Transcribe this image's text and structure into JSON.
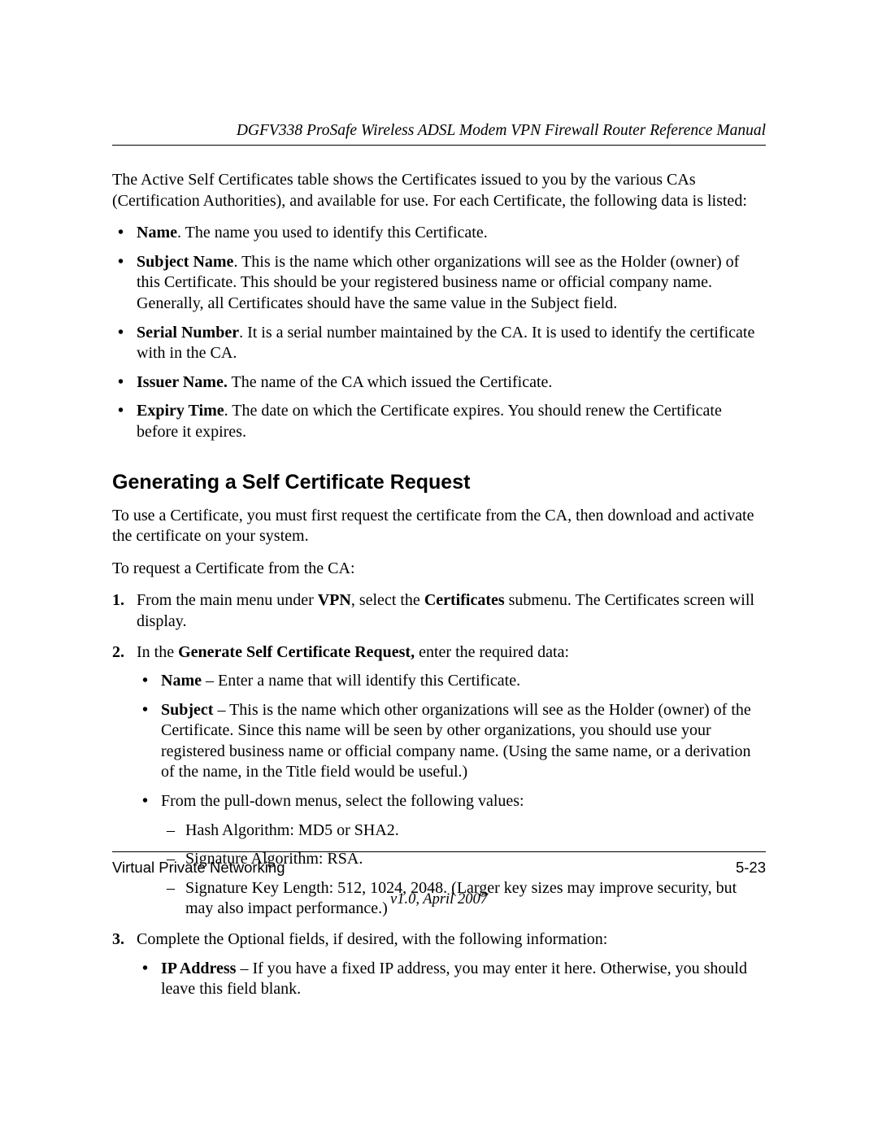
{
  "header": {
    "doc_title": "DGFV338 ProSafe Wireless ADSL Modem VPN Firewall Router Reference Manual"
  },
  "intro": "The Active Self Certificates table shows the Certificates issued to you by the various CAs (Certification Authorities), and available for use. For each Certificate, the following data is listed:",
  "top_list": [
    {
      "term": "Name",
      "desc": ". The name you used to identify this Certificate."
    },
    {
      "term": "Subject Name",
      "desc": ". This is the name which other organizations will see as the Holder (owner) of this Certificate. This should be your registered business name or official company name. Generally, all Certificates should have the same value in the Subject field."
    },
    {
      "term": "Serial Number",
      "desc": ". It is a serial number maintained by the CA. It is used to identify the certificate with in the CA."
    },
    {
      "term": "Issuer Name.",
      "desc": " The name of the CA which issued the Certificate."
    },
    {
      "term": "Expiry Time",
      "desc": ". The date on which the Certificate expires. You should renew the Certificate before it expires."
    }
  ],
  "section_heading": "Generating a Self Certificate Request",
  "para1": "To use a Certificate, you must first request the certificate from the CA, then download and activate the certificate on your system.",
  "para2": "To request a Certificate from the CA:",
  "step1": {
    "marker": "1.",
    "pre": "From the main menu under ",
    "bold1": "VPN",
    "mid": ", select the ",
    "bold2": "Certificates",
    "post": " submenu. The Certificates screen will display."
  },
  "step2": {
    "marker": "2.",
    "pre": "In the ",
    "bold1": "Generate Self Certificate Request,",
    "post": " enter the required data:",
    "sub": [
      {
        "term": "Name",
        "desc": " – Enter a name that will identify this Certificate."
      },
      {
        "term": "Subject",
        "desc": " – This is the name which other organizations will see as the Holder (owner) of the Certificate. Since this name will be seen by other organizations, you should use your registered business name or official company name. (Using the same name, or a derivation of the name, in the Title field would be useful.)"
      }
    ],
    "sub_plain": "From the pull-down menus, select the following values:",
    "dash": [
      "Hash Algorithm: MD5 or SHA2.",
      "Signature Algorithm: RSA.",
      "Signature Key Length: 512, 1024, 2048. (Larger key sizes may improve security, but may also impact performance.)"
    ]
  },
  "step3": {
    "marker": "3.",
    "text": "Complete the Optional fields, if desired, with the following information:",
    "sub": [
      {
        "term": "IP Address",
        "desc": " – If you have a fixed IP address, you may enter it here. Otherwise, you should leave this field blank."
      }
    ]
  },
  "footer": {
    "left": "Virtual Private Networking",
    "right": "5-23",
    "version": "v1.0, April 2007"
  }
}
